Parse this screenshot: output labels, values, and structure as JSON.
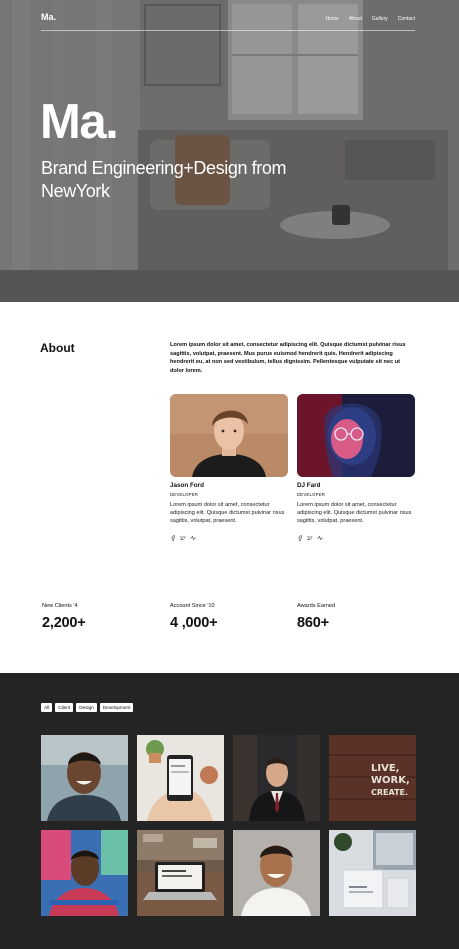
{
  "brand": "Ma.",
  "nav": [
    "Home",
    "About",
    "Gallery",
    "Contact"
  ],
  "hero": {
    "title": "Ma.",
    "subtitle": "Brand Engineering+Design from NewYork"
  },
  "about": {
    "heading": "About",
    "text": "Lorem ipsum dolor sit amet, consectetur adipiscing elit. Quisque dictumst pulvinar risus sagittis, volutpat, praesent. Mus purus euismod hendrerit quis. Hendrerit adipiscing hendrerit eu, at non sed vestibulum, tellus dignissim. Pellentesque vulputate sit nec ut dolor lorem."
  },
  "team": [
    {
      "name": "Jason Ford",
      "role": "DEVELOPER",
      "bio": "Lorem ipsum dolor sit amet, consectetur adipiscing elit. Quisque dictumst pulvinar risus sagittis, volutpat, praesent."
    },
    {
      "name": "DJ Fard",
      "role": "DEVELOPER",
      "bio": "Lorem ipsum dolor sit amet, consectetur adipiscing elit. Quisque dictumst pulvinar risus sagittis, volutpat, praesent."
    }
  ],
  "stats": [
    {
      "label": "New Clients '4",
      "value": "2,200+"
    },
    {
      "label": "Account Since '10",
      "value": "4 ,000+"
    },
    {
      "label": "Awards Earned",
      "value": "860+"
    }
  ],
  "filters": [
    "All",
    "Client",
    "Design",
    "Development"
  ],
  "gallery_sign": [
    "LIVE,",
    "WORK,",
    "CREATE."
  ],
  "colors": {
    "gallery_bg": "#242424",
    "text": "#111111",
    "hero_overlay": "#8d8c8a"
  }
}
